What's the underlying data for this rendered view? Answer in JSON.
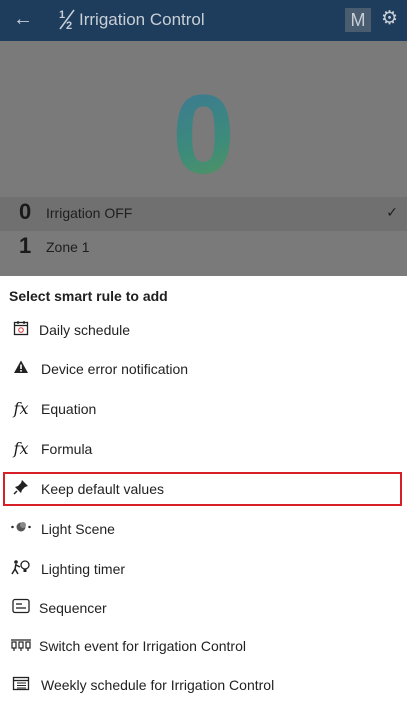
{
  "appbar": {
    "back_icon": "←",
    "title_icon": "1|2",
    "title": "Irrigation Control",
    "mode_badge": "M",
    "gear_icon": "⚙"
  },
  "content": {
    "big_value": "0",
    "rows": [
      {
        "num": "0",
        "label": "Irrigation OFF",
        "selected": true,
        "check": "✓"
      },
      {
        "num": "1",
        "label": "Zone 1",
        "selected": false
      }
    ]
  },
  "sheet": {
    "title": "Select smart rule to add",
    "items": [
      {
        "label": "Daily schedule",
        "icon": "calendar-icon"
      },
      {
        "label": "Device error notification",
        "icon": "warning-icon"
      },
      {
        "label": "Equation",
        "icon": "fx-icon"
      },
      {
        "label": "Formula",
        "icon": "fx-icon"
      },
      {
        "label": "Keep default values",
        "icon": "pin-icon"
      },
      {
        "label": "Light Scene",
        "icon": "light-scene-icon"
      },
      {
        "label": "Lighting timer",
        "icon": "lighting-timer-icon"
      },
      {
        "label": "Sequencer",
        "icon": "sequencer-icon"
      },
      {
        "label": "Switch event for Irrigation Control",
        "icon": "switch-event-icon"
      },
      {
        "label": "Weekly schedule for Irrigation Control",
        "icon": "weekly-calendar-icon"
      }
    ]
  },
  "colors": {
    "appbar": "#1e3c5c",
    "highlight": "#d61f26"
  }
}
